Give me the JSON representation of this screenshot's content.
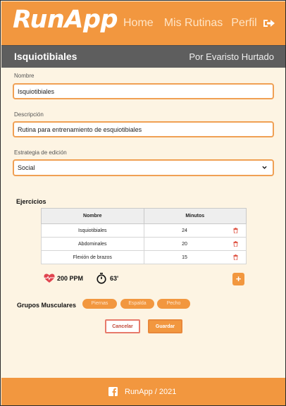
{
  "header": {
    "logo": "RunApp",
    "nav": [
      {
        "label": "Home"
      },
      {
        "label": "Mis Rutinas"
      },
      {
        "label": "Perfil"
      }
    ],
    "logout_icon": "sign-out-icon"
  },
  "subheader": {
    "title": "Isquiotibiales",
    "author": "Por Evaristo Hurtado"
  },
  "form": {
    "name_label": "Nombre",
    "name_value": "Isquiotibiales",
    "description_label": "Descripción",
    "description_value": "Rutina para entrenamiento de esquiotibiales",
    "strategy_label": "Estrategia de edición",
    "strategy_value": "Social"
  },
  "exercises": {
    "title": "Ejercicios",
    "columns": [
      "Nombre",
      "Minutos"
    ],
    "rows": [
      {
        "name": "Isquiotibiales",
        "minutes": "24"
      },
      {
        "name": "Abdominales",
        "minutes": "20"
      },
      {
        "name": "Flexión de brazos",
        "minutes": "15"
      }
    ],
    "delete_icon": "trash-icon"
  },
  "stats": {
    "ppm": "200 PPM",
    "duration": "63'"
  },
  "add_label": "+",
  "muscle_groups": {
    "label": "Grupos Musculares",
    "chips": [
      "Piernas",
      "Espalda",
      "Pecho"
    ]
  },
  "actions": {
    "cancel": "Cancelar",
    "save": "Guardar"
  },
  "footer": {
    "text": "RunApp / 2021",
    "icon": "facebook-icon"
  },
  "colors": {
    "accent": "#f2973f",
    "subheader": "#5e5e5e",
    "background": "#fdf4e3",
    "danger": "#e05a4a"
  }
}
